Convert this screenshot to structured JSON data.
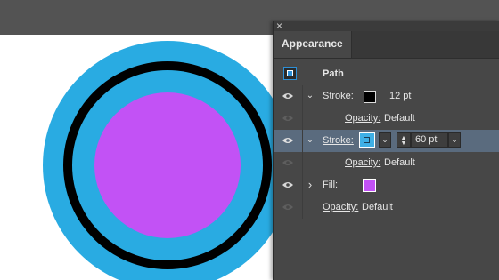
{
  "colors": {
    "outer_stroke": "#29abe2",
    "inner_stroke": "#000000",
    "fill": "#c252f5",
    "selection_row": "#5a6b7e"
  },
  "panel": {
    "close_glyph": "×",
    "tab_label": "Appearance",
    "path_label": "Path",
    "rows": [
      {
        "label": "Stroke:",
        "swatch_color": "#000000",
        "value": "12 pt"
      },
      {
        "label": "Opacity:",
        "value": "Default"
      },
      {
        "label": "Stroke:",
        "swatch_color": "#29abe2",
        "weight": "60 pt"
      },
      {
        "label": "Opacity:",
        "value": "Default"
      },
      {
        "label": "Fill:",
        "swatch_color": "#c252f5"
      },
      {
        "label": "Opacity:",
        "value": "Default"
      }
    ]
  },
  "icons": {
    "chevron_down": "⌄",
    "chevron_right": "›",
    "step_up": "▲",
    "step_down": "▼",
    "dropdown": "⌄"
  }
}
